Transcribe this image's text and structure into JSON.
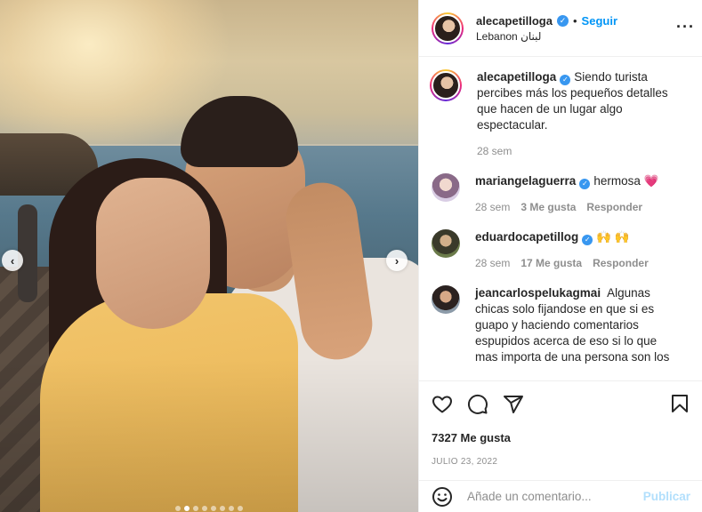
{
  "post": {
    "username": "alecapetilloga",
    "verified": true,
    "follow_separator": "•",
    "follow_label": "Seguir",
    "location": "Lebanon لبنان",
    "more_icon": "more-icon"
  },
  "carousel": {
    "prev_icon": "chevron-left-icon",
    "next_icon": "chevron-right-icon",
    "prev_glyph": "‹",
    "next_glyph": "›",
    "dots_total": 8,
    "active_dot": 1
  },
  "caption": {
    "username": "alecapetilloga",
    "text": "Siendo turista percibes más los pequeños detalles que hacen de un lugar algo espectacular.",
    "time": "28 sem"
  },
  "comments": [
    {
      "username": "mariangelaguerra",
      "verified": true,
      "text": "hermosa",
      "emoji": "💗",
      "time": "28 sem",
      "likes": "3 Me gusta",
      "reply": "Responder"
    },
    {
      "username": "eduardocapetillog",
      "verified": true,
      "text": "",
      "emoji": "🙌 🙌",
      "time": "28 sem",
      "likes": "17 Me gusta",
      "reply": "Responder"
    },
    {
      "username": "jeancarlospelukagmai",
      "verified": false,
      "text": "Algunas chicas solo fijandose en que si es guapo y haciendo comentarios espupidos acerca de eso si lo que mas importa de una persona son los"
    }
  ],
  "actions": {
    "like_icon": "heart-icon",
    "comment_icon": "comment-icon",
    "share_icon": "share-icon",
    "save_icon": "bookmark-icon"
  },
  "likes": "7327 Me gusta",
  "date": "JULIO 23, 2022",
  "add_comment": {
    "placeholder": "Añade un comentario...",
    "post_label": "Publicar",
    "emoji_icon": "emoji-icon"
  },
  "colors": {
    "accent": "#0095f6",
    "verified": "#3897f0",
    "muted": "#8e8e8e",
    "post_disabled": "#b2dffc"
  }
}
